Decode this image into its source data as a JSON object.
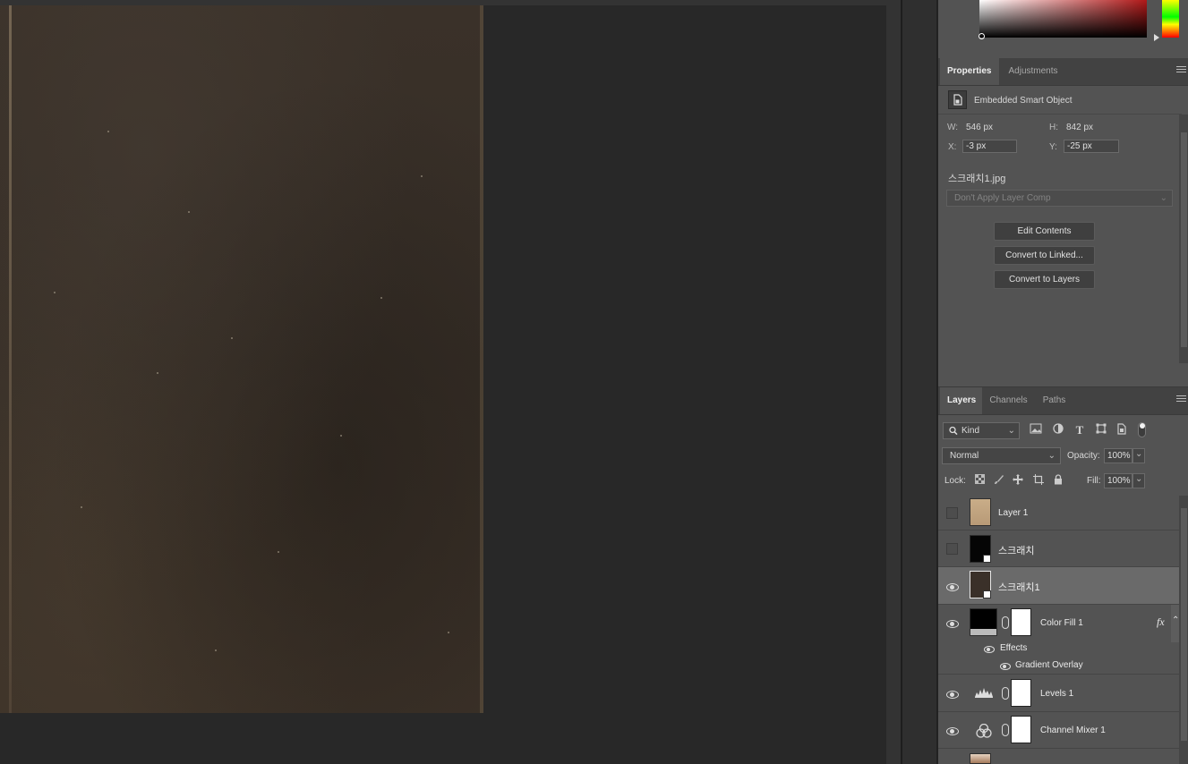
{
  "document": {
    "texture": "dark brown scratched paper"
  },
  "color_picker": {
    "base_hue": "#b01818"
  },
  "properties_panel": {
    "tabs": [
      {
        "label": "Properties",
        "active": true
      },
      {
        "label": "Adjustments",
        "active": false
      }
    ],
    "object_type": "Embedded Smart Object",
    "width_label": "W:",
    "width_value": "546 px",
    "height_label": "H:",
    "height_value": "842 px",
    "x_label": "X:",
    "x_value": "-3 px",
    "y_label": "Y:",
    "y_value": "-25 px",
    "filename": "스크래치1.jpg",
    "layer_comp_placeholder": "Don't Apply Layer Comp",
    "buttons": {
      "edit": "Edit Contents",
      "convert_linked": "Convert to Linked...",
      "convert_layers": "Convert to Layers"
    }
  },
  "layers_panel": {
    "tabs": [
      {
        "label": "Layers",
        "active": true
      },
      {
        "label": "Channels",
        "active": false
      },
      {
        "label": "Paths",
        "active": false
      }
    ],
    "kind_filter": "Kind",
    "blend_mode": "Normal",
    "opacity_label": "Opacity:",
    "opacity_value": "100%",
    "lock_label": "Lock:",
    "fill_label": "Fill:",
    "fill_value": "100%",
    "layers": [
      {
        "name": "Layer 1",
        "visible": false
      },
      {
        "name": "스크래치",
        "visible": false
      },
      {
        "name": "스크래치1",
        "visible": true,
        "selected": true
      },
      {
        "name": "Color Fill 1",
        "visible": true,
        "fx": "fx",
        "effects_label": "Effects",
        "effect": "Gradient Overlay"
      },
      {
        "name": "Levels 1",
        "visible": true
      },
      {
        "name": "Channel Mixer 1",
        "visible": true
      }
    ]
  }
}
